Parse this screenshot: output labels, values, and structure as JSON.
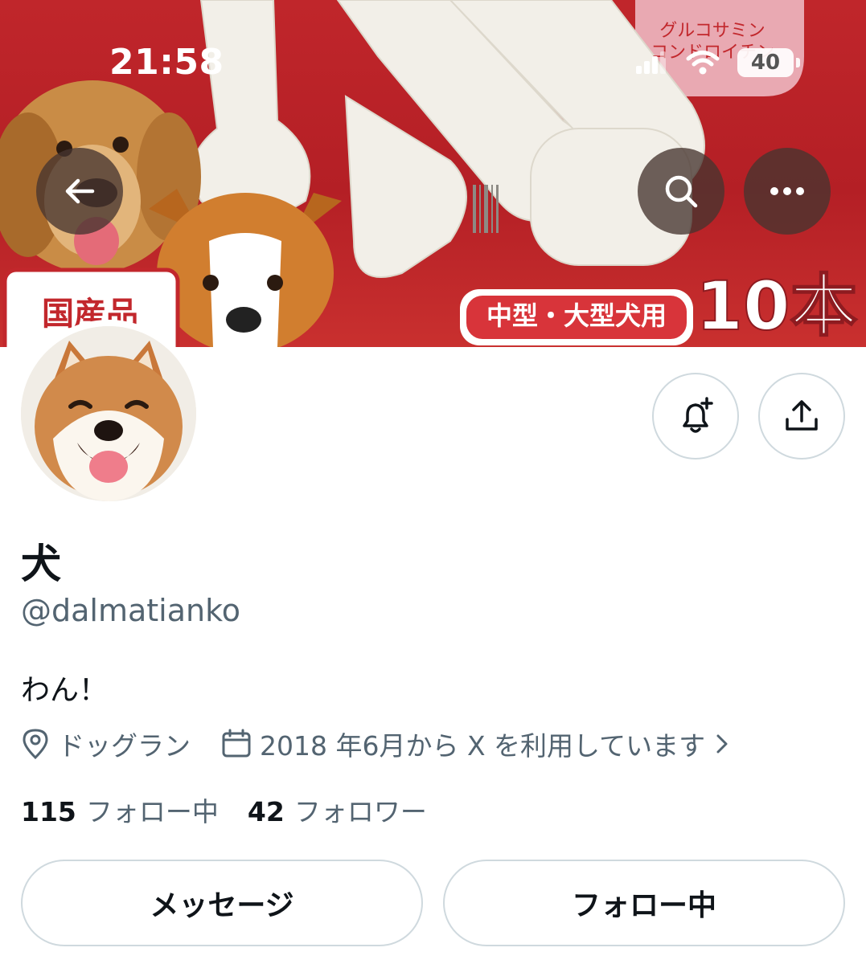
{
  "status_bar": {
    "time": "21:58",
    "battery": "40"
  },
  "banner": {
    "description_icon_names": [
      "back-arrow-icon",
      "search-icon",
      "more-icon"
    ],
    "label_product_size": "中型・大型犬用",
    "label_count": "10本",
    "label_domestic": "国産品",
    "label_ingredients_1": "グルコサミン",
    "label_ingredients_2": "コンドロイチン"
  },
  "profile": {
    "display_name": "犬",
    "handle": "@dalmatianko",
    "bio": "わん！",
    "location": "ドッグラン",
    "joined": "2018 年6月から X を利用しています",
    "following_count": "115",
    "following_label": "フォロー中",
    "followers_count": "42",
    "followers_label": "フォロワー"
  },
  "buttons": {
    "message": "メッセージ",
    "following": "フォロー中"
  },
  "colors": {
    "banner_red": "#b41f25",
    "text_primary": "#0f1419",
    "text_secondary": "#536471",
    "border": "#cfd9de"
  }
}
